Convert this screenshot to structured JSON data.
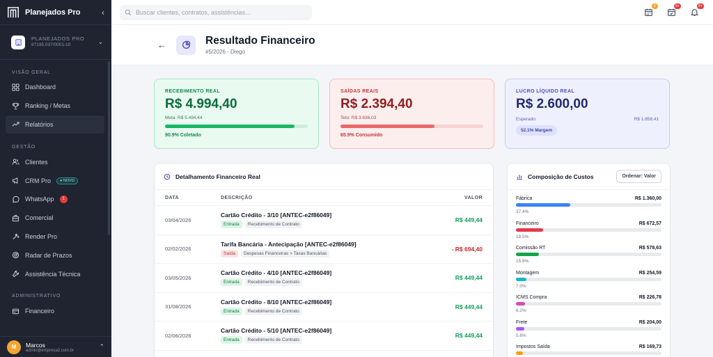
{
  "app": {
    "name": "Planejados Pro"
  },
  "company": {
    "name": "PLANEJADOS PRO",
    "cnpj": "87195.037/0001-10"
  },
  "sidebar": {
    "sections": [
      {
        "label": "VISÃO GERAL"
      },
      {
        "label": "GESTÃO"
      },
      {
        "label": "ADMINISTRATIVO"
      }
    ],
    "items": [
      {
        "label": "Dashboard",
        "icon": "grid-icon"
      },
      {
        "label": "Ranking / Metas",
        "icon": "trophy-icon"
      },
      {
        "label": "Relatórios",
        "icon": "trend-icon",
        "active": true
      },
      {
        "label": "Clientes",
        "icon": "users-icon"
      },
      {
        "label": "CRM Pro",
        "icon": "megaphone-icon",
        "badge": "● NOVO"
      },
      {
        "label": "WhatsApp",
        "icon": "whatsapp-icon",
        "badge": "1"
      },
      {
        "label": "Comercial",
        "icon": "briefcase-icon"
      },
      {
        "label": "Render Pro",
        "icon": "wand-icon"
      },
      {
        "label": "Radar de Prazos",
        "icon": "radar-icon"
      },
      {
        "label": "Assistência Técnica",
        "icon": "wrench-icon"
      },
      {
        "label": "Financeiro",
        "icon": "card-icon"
      }
    ]
  },
  "user": {
    "initial": "M",
    "name": "Marcos",
    "email": "admin@empresa2.com.br"
  },
  "topbar": {
    "search_placeholder": "Buscar clientes, contratos, assistências...",
    "notifications": [
      {
        "icon": "calendar-icon",
        "count": "1",
        "color": "#f2a531"
      },
      {
        "icon": "calendar-check-icon",
        "count": "9+",
        "color": "#e23b3b"
      },
      {
        "icon": "bell-icon",
        "count": "9+",
        "color": "#e23b3b"
      }
    ]
  },
  "header": {
    "title": "Resultado Financeiro",
    "subtitle": "#5/2026 - Diego"
  },
  "kpis": {
    "recebimento": {
      "label": "RECEBIMENTO REAL",
      "value": "R$ 4.994,40",
      "sub": "Meta: R$ 5.494,44",
      "progress": 0.909,
      "foot": "90.9% Coletado"
    },
    "saidas": {
      "label": "SAÍDAS REAIS",
      "value": "R$ 2.394,40",
      "sub": "Teto: R$ 3.636,03",
      "progress": 0.659,
      "foot": "65.9% Consumido"
    },
    "lucro": {
      "label": "LUCRO LÍQUIDO REAL",
      "value": "R$ 2.600,00",
      "expected_label": "Esperado:",
      "expected_value": "R$ 1.858,41",
      "margin": "52.1% Margem"
    }
  },
  "detail": {
    "title": "Detalhamento Financeiro Real",
    "columns": {
      "date": "DATA",
      "desc": "DESCRIÇÃO",
      "value": "VALOR"
    },
    "rows": [
      {
        "date": "03/04/2026",
        "desc": "Cartão Crédito - 3/10 [ANTEC-e2f86049]",
        "type": "Entrada",
        "category": "Recebimento de Contrato",
        "value": "R$ 449,44",
        "direction": "in"
      },
      {
        "date": "02/02/2026",
        "desc": "Tarifa Bancária - Antecipação [ANTEC-e2f86049]",
        "type": "Saída",
        "category": "Despesas Financeiras > Taxas Bancárias",
        "value": "- R$ 694,40",
        "direction": "out"
      },
      {
        "date": "03/05/2026",
        "desc": "Cartão Crédito - 4/10 [ANTEC-e2f86049]",
        "type": "Entrada",
        "category": "Recebimento de Contrato",
        "value": "R$ 449,44",
        "direction": "in"
      },
      {
        "date": "31/08/2026",
        "desc": "Cartão Crédito - 8/10 [ANTEC-e2f86049]",
        "type": "Entrada",
        "category": "Recebimento de Contrato",
        "value": "R$ 449,44",
        "direction": "in"
      },
      {
        "date": "02/06/2026",
        "desc": "Cartão Crédito - 5/10 [ANTEC-e2f86049]",
        "type": "Entrada",
        "category": "Recebimento de Contrato",
        "value": "R$ 449,44",
        "direction": "in"
      }
    ]
  },
  "composition": {
    "title": "Composição de Custos",
    "order_label": "Ordenar: Valor",
    "items": [
      {
        "name": "Fábrica",
        "amount": "R$ 1.360,00",
        "pct": "37.4%",
        "fraction": 0.374,
        "color": "#3b82f6"
      },
      {
        "name": "Financeiro",
        "amount": "R$ 672,57",
        "pct": "18.5%",
        "fraction": 0.185,
        "color": "#e23b4b"
      },
      {
        "name": "Comissão RT",
        "amount": "R$ 578,63",
        "pct": "15.9%",
        "fraction": 0.159,
        "color": "#16a34a"
      },
      {
        "name": "Montagem",
        "amount": "R$ 254,59",
        "pct": "7.0%",
        "fraction": 0.07,
        "color": "#14b8c8"
      },
      {
        "name": "ICMS Compra",
        "amount": "R$ 226,78",
        "pct": "6.2%",
        "fraction": 0.062,
        "color": "#d946b8"
      },
      {
        "name": "Frete",
        "amount": "R$ 204,00",
        "pct": "5.6%",
        "fraction": 0.056,
        "color": "#a855f7"
      },
      {
        "name": "Impostos Saída",
        "amount": "R$ 169,73",
        "pct": "",
        "fraction": 0.047,
        "color": "#f59e0b"
      }
    ]
  }
}
